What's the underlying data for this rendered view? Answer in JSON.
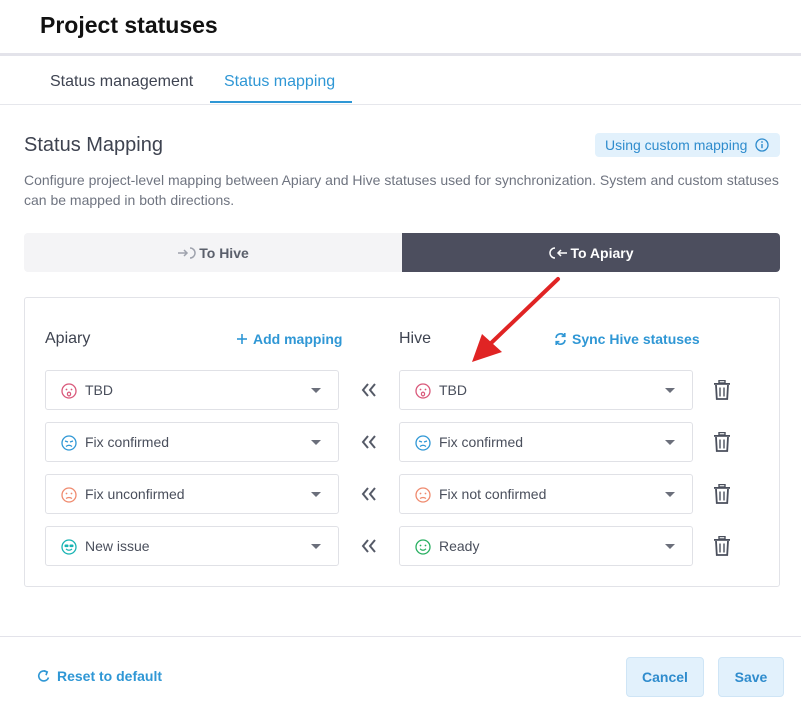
{
  "header": {
    "title": "Project statuses"
  },
  "tabs": [
    {
      "label": "Status management",
      "active": false
    },
    {
      "label": "Status mapping",
      "active": true
    }
  ],
  "section": {
    "title": "Status Mapping",
    "badge": "Using custom mapping",
    "description": "Configure project-level mapping between Apiary and Hive statuses used for synchronization. System and custom statuses can be mapped in both directions."
  },
  "direction": {
    "to_hive": "To Hive",
    "to_apiary": "To Apiary",
    "selected": "To Apiary"
  },
  "mapping": {
    "apiary_title": "Apiary",
    "hive_title": "Hive",
    "add_mapping": "Add mapping",
    "sync_hive": "Sync Hive statuses",
    "rows": [
      {
        "apiary": {
          "label": "TBD",
          "icon": "surprised-face-icon",
          "color": "#d9587a"
        },
        "hive": {
          "label": "TBD",
          "icon": "surprised-face-icon",
          "color": "#d9587a"
        }
      },
      {
        "apiary": {
          "label": "Fix confirmed",
          "icon": "crying-face-icon",
          "color": "#2f97d5"
        },
        "hive": {
          "label": "Fix confirmed",
          "icon": "crying-face-icon",
          "color": "#2f97d5"
        }
      },
      {
        "apiary": {
          "label": "Fix unconfirmed",
          "icon": "frown-face-icon",
          "color": "#ef8a6e"
        },
        "hive": {
          "label": "Fix not confirmed",
          "icon": "frown-face-icon",
          "color": "#ef8a6e"
        }
      },
      {
        "apiary": {
          "label": "New issue",
          "icon": "sunglasses-face-icon",
          "color": "#17b3b3"
        },
        "hive": {
          "label": "Ready",
          "icon": "smile-face-icon",
          "color": "#27ae60"
        }
      }
    ]
  },
  "footer": {
    "reset": "Reset to default",
    "cancel": "Cancel",
    "save": "Save"
  },
  "colors": {
    "accent": "#2f97d5",
    "active_toggle": "#4c4e5e",
    "annotation_arrow": "#e02424"
  }
}
